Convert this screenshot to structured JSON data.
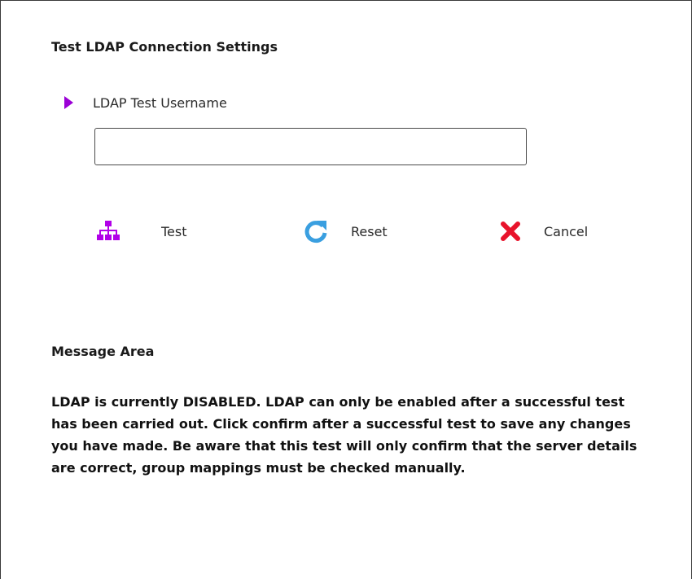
{
  "section": {
    "title": "Test LDAP Connection Settings"
  },
  "field": {
    "label": "LDAP Test Username",
    "value": "",
    "placeholder": ""
  },
  "actions": {
    "test": {
      "label": "Test",
      "icon": "sitemap-icon",
      "color": "#b100e8"
    },
    "reset": {
      "label": "Reset",
      "icon": "refresh-icon",
      "color": "#3a9fe0"
    },
    "cancel": {
      "label": "Cancel",
      "icon": "close-icon",
      "color": "#e8132b"
    }
  },
  "message": {
    "title": "Message Area",
    "body": "LDAP is currently DISABLED. LDAP can only be enabled after a successful test has been carried out. Click confirm after a successful test to save any changes you have made. Be aware that this test will only confirm that the server details are correct, group mappings must be checked manually."
  },
  "colors": {
    "marker": "#9b00d6",
    "border": "#4a4a4a"
  }
}
